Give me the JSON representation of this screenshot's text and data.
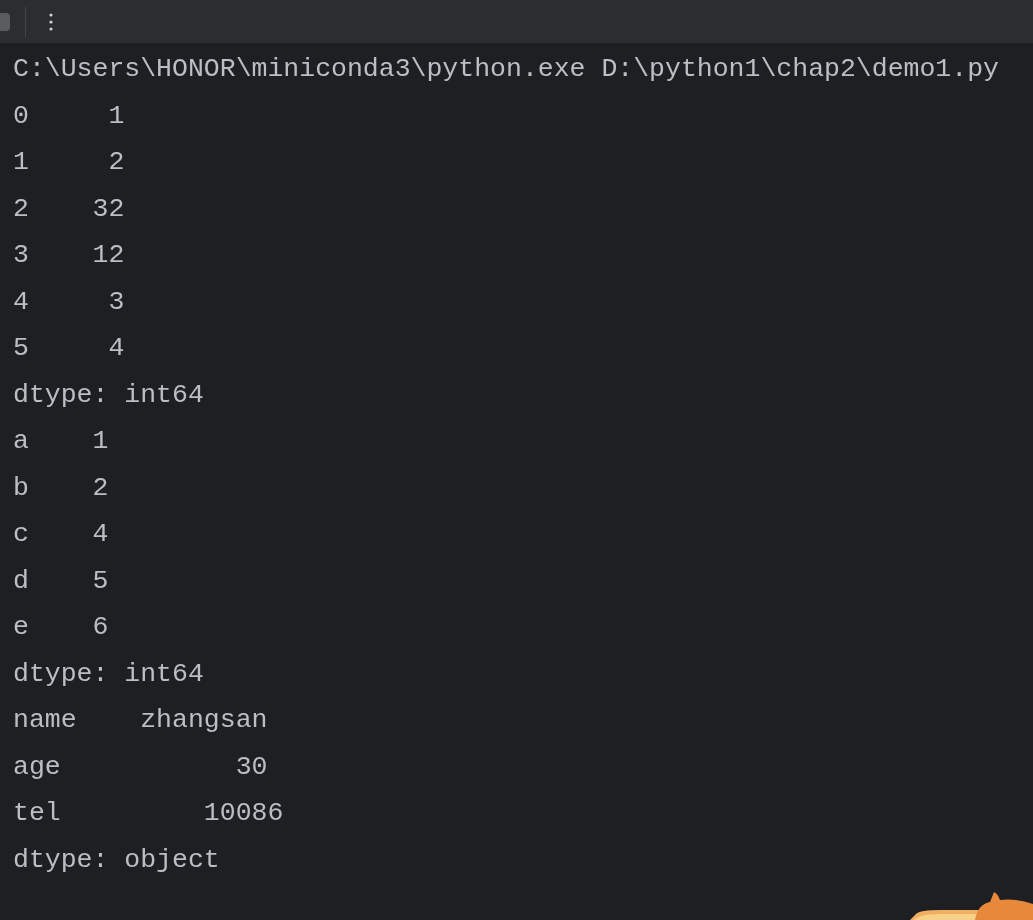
{
  "console": {
    "lines": [
      "C:\\Users\\HONOR\\miniconda3\\python.exe D:\\python1\\chap2\\demo1.py",
      "0     1",
      "1     2",
      "2    32",
      "3    12",
      "4     3",
      "5     4",
      "dtype: int64",
      "a    1",
      "b    2",
      "c    4",
      "d    5",
      "e    6",
      "dtype: int64",
      "name    zhangsan",
      "age           30",
      "tel         10086",
      "dtype: object"
    ]
  }
}
